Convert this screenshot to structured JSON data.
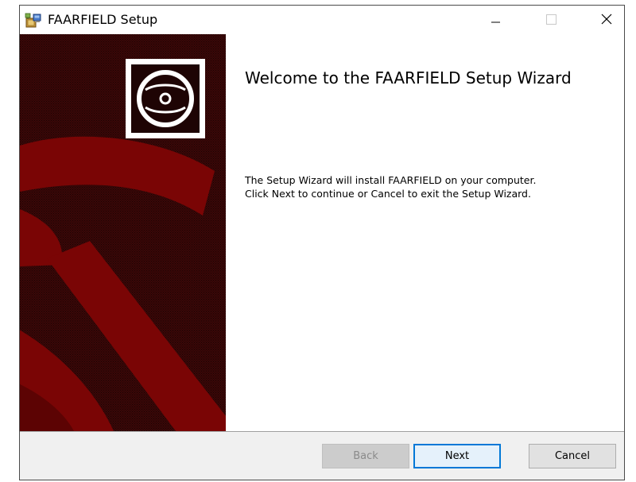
{
  "window": {
    "title": "FAARFIELD Setup"
  },
  "titlebar_controls": {
    "minimize": "minimize-icon",
    "maximize": "maximize-icon",
    "close": "close-icon"
  },
  "banner": {
    "icon": "cd-disc-icon",
    "colors": {
      "background": "#3a0808",
      "accent": "#7a0505"
    }
  },
  "content": {
    "title": "Welcome to the FAARFIELD Setup Wizard",
    "body_lines": [
      "The Setup Wizard will install FAARFIELD on your computer.",
      "Click Next to continue or Cancel to exit the Setup Wizard."
    ]
  },
  "buttons": {
    "back": "Back",
    "next": "Next",
    "cancel": "Cancel"
  },
  "colors": {
    "focus_border": "#0078d7",
    "footer_bg": "#f0f0f0"
  }
}
